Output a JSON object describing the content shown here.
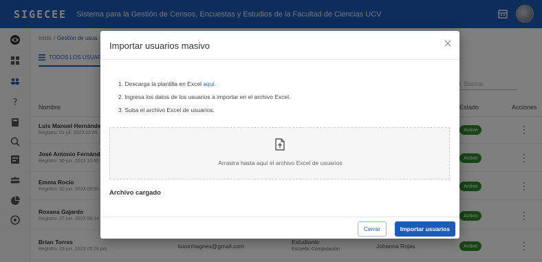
{
  "app": {
    "logo": "SIGECEE",
    "title": "Sistema para la Gestión de Censos, Encuestas y Estudios de la Facultad de Ciencias UCV"
  },
  "breadcrumb": {
    "home": "Inicio",
    "current": "Gestión de usua"
  },
  "tab": {
    "label": "TODOS LOS USUAR"
  },
  "search": {
    "placeholder": "Buscar"
  },
  "table": {
    "headers": {
      "name": "Nombre",
      "status": "Estado",
      "actions": "Acciones"
    },
    "rows": [
      {
        "name": "Luis Manuel Hernández",
        "registered": "Registro: 01 jul. 2023 02:05",
        "email": "",
        "role": "",
        "school": "",
        "creator": "",
        "status": "Activo"
      },
      {
        "name": "José Antonio Fernández",
        "registered": "Registro: 30 jun. 2023 10:40",
        "email": "",
        "role": "",
        "school": "",
        "creator": "",
        "status": "Activo"
      },
      {
        "name": "Emma Rocío",
        "registered": "Registro: 30 jun. 2023 09:55",
        "email": "",
        "role": "",
        "school": "",
        "creator": "",
        "status": "Activo"
      },
      {
        "name": "Roxana Gajardo",
        "registered": "Registro: 27 jun. 2023 06:14",
        "email": "",
        "role": "",
        "school": "",
        "creator": "",
        "status": "Activo"
      },
      {
        "name": "Brian Torres",
        "registered": "Registro: 23 jun. 2023 05:26 pm",
        "email": "luxormagnes@gmail.com",
        "role": "Estudiante",
        "school": "Escuela: Computación",
        "creator": "Johanna Rojas",
        "status": "Activo"
      }
    ]
  },
  "modal": {
    "title": "Importar usuarios masivo",
    "step1_prefix": "1. Descarga la plantilla en Excel ",
    "step1_link": "aquí",
    "step1_suffix": ".",
    "step2": "2. Ingresa los datos de los usuarios a importar en el archivo Excel.",
    "step3": "3. Suba el archivo Excel de usuarios.",
    "dropzone_text": "Arrastra hasta aquí el archivo Excel de usuarios",
    "loaded_title": "Archivo cargado",
    "cancel_label": "Cerrar",
    "import_label": "Importar usuarios"
  },
  "colors": {
    "primary": "#1c5bb6",
    "active": "#2f8a2c",
    "link": "#1c6fd6"
  }
}
